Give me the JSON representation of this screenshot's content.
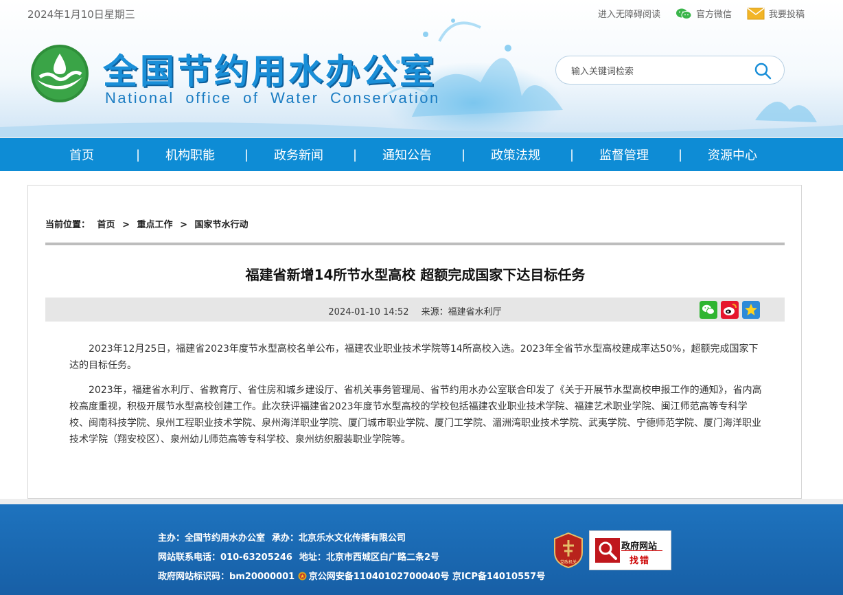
{
  "topbar": {
    "date": "2024年1月10日星期三",
    "links": [
      {
        "label": "进入无障碍阅读",
        "icon": ""
      },
      {
        "label": "官方微信",
        "icon": "wechat-icon"
      },
      {
        "label": "我要投稿",
        "icon": "mail-icon"
      }
    ]
  },
  "header": {
    "title_cn": "全国节约用水办公室",
    "title_en": "National office of Water Conservation",
    "search_placeholder": "输入关键词检索"
  },
  "nav": {
    "items": [
      "首页",
      "机构职能",
      "政务新闻",
      "通知公告",
      "政策法规",
      "监督管理",
      "资源中心"
    ],
    "separator": "|"
  },
  "breadcrumb": {
    "prefix": "当前位置：",
    "items": [
      "首页",
      "重点工作",
      "国家节水行动"
    ],
    "separator": ">"
  },
  "article": {
    "title": "福建省新增14所节水型高校 超额完成国家下达目标任务",
    "datetime": "2024-01-10 14:52",
    "source": "来源：福建省水利厅",
    "paragraphs": [
      "2023年12月25日，福建省2023年度节水型高校名单公布，福建农业职业技术学院等14所高校入选。2023年全省节水型高校建成率达50%，超额完成国家下达的目标任务。",
      "2023年，福建省水利厅、省教育厅、省住房和城乡建设厅、省机关事务管理局、省节约用水办公室联合印发了《关于开展节水型高校申报工作的通知》，省内高校高度重视，积极开展节水型高校创建工作。此次获评福建省2023年度节水型高校的学校包括福建农业职业技术学院、福建艺术职业学院、闽江师范高等专科学校、闽南科技学院、泉州工程职业技术学院、泉州海洋职业学院、厦门城市职业学院、厦门工学院、湄洲湾职业技术学院、武夷学院、宁德师范学院、厦门海洋职业技术学院（翔安校区）、泉州幼儿师范高等专科学校、泉州纺织服装职业学院等。"
    ],
    "share": [
      "wechat",
      "weibo",
      "favorite"
    ]
  },
  "footer": {
    "host_label": "主办：",
    "host": "全国节约用水办公室",
    "undertaker_label": "承办：",
    "undertaker": "北京乐水文化传播有限公司",
    "phone_label": "网站联系电话：",
    "phone": "010-63205246",
    "address_label": "地址：",
    "address": "北京市西城区白广路二条2号",
    "id_label": "政府网站标识码：",
    "id": "bm20000001",
    "police": "京公网安备11040102700040号",
    "icp": "京ICP备14010557号",
    "badge_party_text": "党政机关",
    "badge_error_line1": "政府网站",
    "badge_error_line2": "找错"
  },
  "colors": {
    "nav_bg": "#0e8cd5",
    "footer_bg": "#1e73be",
    "title_blue": "#1a8fd8"
  }
}
